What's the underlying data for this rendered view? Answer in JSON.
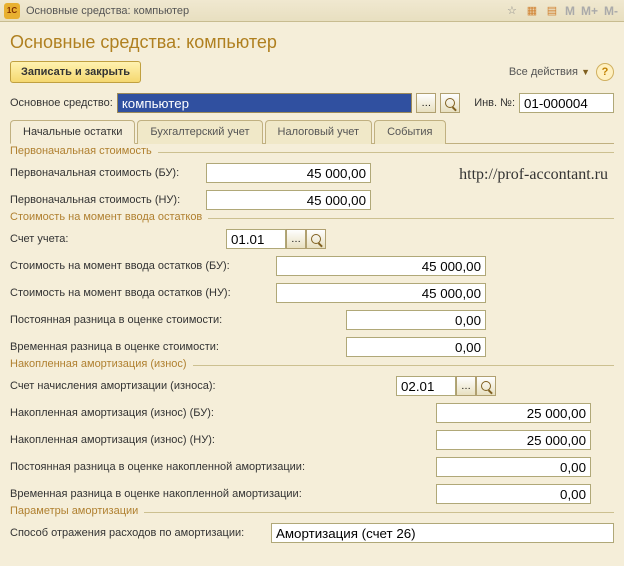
{
  "titlebar": {
    "icon_text": "1C",
    "title": "Основные средства: компьютер",
    "m_buttons": [
      "M",
      "M+",
      "M-"
    ]
  },
  "page_title": "Основные средства: компьютер",
  "toolbar": {
    "save_close": "Записать и закрыть",
    "all_actions": "Все действия"
  },
  "header_fields": {
    "main_asset_label": "Основное средство:",
    "main_asset_value": "компьютер",
    "inv_label": "Инв. №:",
    "inv_value": "01-000004"
  },
  "tabs": [
    "Начальные остатки",
    "Бухгалтерский учет",
    "Налоговый учет",
    "События"
  ],
  "groups": {
    "initial_cost": {
      "title": "Первоначальная стоимость",
      "rows": [
        {
          "label": "Первоначальная стоимость (БУ):",
          "value": "45 000,00",
          "lbl_w": 190,
          "inp_w": 165
        },
        {
          "label": "Первоначальная стоимость (НУ):",
          "value": "45 000,00",
          "lbl_w": 190,
          "inp_w": 165
        }
      ]
    },
    "balance_cost": {
      "title": "Стоимость на момент ввода остатков",
      "account_label": "Счет учета:",
      "account_value": "01.01",
      "rows": [
        {
          "label": "Стоимость на момент ввода остатков (БУ):",
          "value": "45 000,00",
          "lbl_w": 260,
          "inp_w": 210
        },
        {
          "label": "Стоимость на момент ввода остатков (НУ):",
          "value": "45 000,00",
          "lbl_w": 260,
          "inp_w": 210
        },
        {
          "label": "Постоянная разница в оценке стоимости:",
          "value": "0,00",
          "lbl_w": 330,
          "inp_w": 140
        },
        {
          "label": "Временная разница в оценке стоимости:",
          "value": "0,00",
          "lbl_w": 330,
          "inp_w": 140
        }
      ]
    },
    "depreciation": {
      "title": "Накопленная амортизация (износ)",
      "account_label": "Счет начисления амортизации (износа):",
      "account_value": "02.01",
      "rows": [
        {
          "label": "Накопленная амортизация (износ) (БУ):",
          "value": "25 000,00",
          "lbl_w": 420,
          "inp_w": 155
        },
        {
          "label": "Накопленная амортизация (износ) (НУ):",
          "value": "25 000,00",
          "lbl_w": 420,
          "inp_w": 155
        },
        {
          "label": "Постоянная разница в оценке накопленной амортизации:",
          "value": "0,00",
          "lbl_w": 420,
          "inp_w": 155
        },
        {
          "label": "Временная разница в оценке накопленной амортизации:",
          "value": "0,00",
          "lbl_w": 420,
          "inp_w": 155
        }
      ]
    },
    "params": {
      "title": "Параметры амортизации",
      "expense_label": "Способ отражения расходов по амортизации:",
      "expense_value": "Амортизация (счет 26)"
    }
  },
  "watermark": "http://prof-accontant.ru"
}
